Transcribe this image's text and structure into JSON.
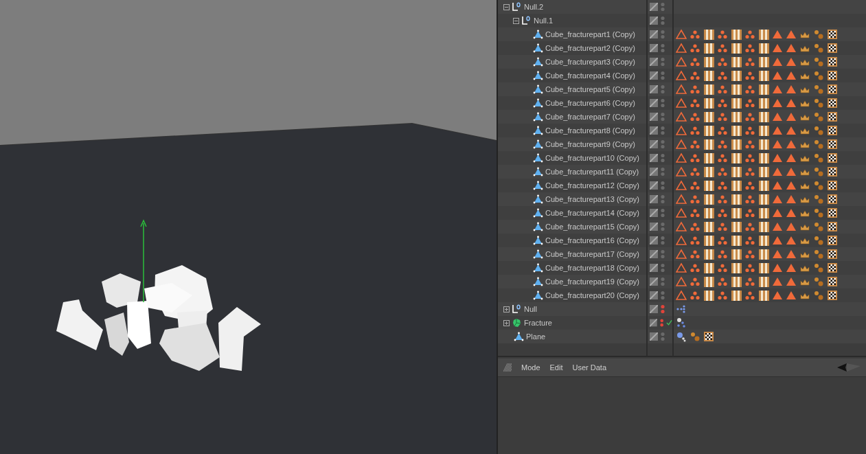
{
  "objects": [
    {
      "name": "Null.2",
      "kind": "null",
      "expanded": true,
      "color": "#6a6a6a",
      "check": false,
      "children": [
        {
          "name": "Null.1",
          "kind": "null",
          "expanded": true,
          "color": "#6a6a6a",
          "check": false,
          "children": [
            {
              "name": "Cube_fracturepart1 (Copy)",
              "kind": "polygon",
              "color": "#6a6a6a",
              "check": false,
              "tags": [
                {
                  "kind": "phong"
                },
                {
                  "kind": "dots"
                },
                {
                  "kind": "checker"
                },
                {
                  "kind": "dots"
                },
                {
                  "kind": "checker"
                },
                {
                  "kind": "dots"
                },
                {
                  "kind": "checker"
                },
                {
                  "kind": "tri"
                },
                {
                  "kind": "tri"
                },
                {
                  "kind": "crown"
                },
                {
                  "kind": "spheres"
                },
                {
                  "kind": "board"
                }
              ]
            },
            {
              "name": "Cube_fracturepart2 (Copy)",
              "kind": "polygon",
              "color": "#6a6a6a",
              "check": false,
              "tags": [
                {
                  "kind": "phong"
                },
                {
                  "kind": "dots"
                },
                {
                  "kind": "checker"
                },
                {
                  "kind": "dots"
                },
                {
                  "kind": "checker"
                },
                {
                  "kind": "dots"
                },
                {
                  "kind": "checker"
                },
                {
                  "kind": "tri"
                },
                {
                  "kind": "tri"
                },
                {
                  "kind": "crown"
                },
                {
                  "kind": "spheres"
                },
                {
                  "kind": "board"
                }
              ]
            },
            {
              "name": "Cube_fracturepart3 (Copy)",
              "kind": "polygon",
              "color": "#6a6a6a",
              "check": false,
              "tags": [
                {
                  "kind": "phong"
                },
                {
                  "kind": "dots"
                },
                {
                  "kind": "checker"
                },
                {
                  "kind": "dots"
                },
                {
                  "kind": "checker"
                },
                {
                  "kind": "dots"
                },
                {
                  "kind": "checker"
                },
                {
                  "kind": "tri"
                },
                {
                  "kind": "tri"
                },
                {
                  "kind": "crown"
                },
                {
                  "kind": "spheres"
                },
                {
                  "kind": "board"
                }
              ]
            },
            {
              "name": "Cube_fracturepart4 (Copy)",
              "kind": "polygon",
              "color": "#6a6a6a",
              "check": false,
              "tags": [
                {
                  "kind": "phong"
                },
                {
                  "kind": "dots"
                },
                {
                  "kind": "checker"
                },
                {
                  "kind": "dots"
                },
                {
                  "kind": "checker"
                },
                {
                  "kind": "dots"
                },
                {
                  "kind": "checker"
                },
                {
                  "kind": "tri"
                },
                {
                  "kind": "tri"
                },
                {
                  "kind": "crown"
                },
                {
                  "kind": "spheres"
                },
                {
                  "kind": "board"
                }
              ]
            },
            {
              "name": "Cube_fracturepart5 (Copy)",
              "kind": "polygon",
              "color": "#6a6a6a",
              "check": false,
              "tags": [
                {
                  "kind": "phong"
                },
                {
                  "kind": "dots"
                },
                {
                  "kind": "checker"
                },
                {
                  "kind": "dots"
                },
                {
                  "kind": "checker"
                },
                {
                  "kind": "dots"
                },
                {
                  "kind": "checker"
                },
                {
                  "kind": "tri"
                },
                {
                  "kind": "tri"
                },
                {
                  "kind": "crown"
                },
                {
                  "kind": "spheres"
                },
                {
                  "kind": "board"
                }
              ]
            },
            {
              "name": "Cube_fracturepart6 (Copy)",
              "kind": "polygon",
              "color": "#6a6a6a",
              "check": false,
              "tags": [
                {
                  "kind": "phong"
                },
                {
                  "kind": "dots"
                },
                {
                  "kind": "checker"
                },
                {
                  "kind": "dots"
                },
                {
                  "kind": "checker"
                },
                {
                  "kind": "dots"
                },
                {
                  "kind": "checker"
                },
                {
                  "kind": "tri"
                },
                {
                  "kind": "tri"
                },
                {
                  "kind": "crown"
                },
                {
                  "kind": "spheres"
                },
                {
                  "kind": "board"
                }
              ]
            },
            {
              "name": "Cube_fracturepart7 (Copy)",
              "kind": "polygon",
              "color": "#6a6a6a",
              "check": false,
              "tags": [
                {
                  "kind": "phong"
                },
                {
                  "kind": "dots"
                },
                {
                  "kind": "checker"
                },
                {
                  "kind": "dots"
                },
                {
                  "kind": "checker"
                },
                {
                  "kind": "dots"
                },
                {
                  "kind": "checker"
                },
                {
                  "kind": "tri"
                },
                {
                  "kind": "tri"
                },
                {
                  "kind": "crown"
                },
                {
                  "kind": "spheres"
                },
                {
                  "kind": "board"
                }
              ]
            },
            {
              "name": "Cube_fracturepart8 (Copy)",
              "kind": "polygon",
              "color": "#6a6a6a",
              "check": false,
              "tags": [
                {
                  "kind": "phong"
                },
                {
                  "kind": "dots"
                },
                {
                  "kind": "checker"
                },
                {
                  "kind": "dots"
                },
                {
                  "kind": "checker"
                },
                {
                  "kind": "dots"
                },
                {
                  "kind": "checker"
                },
                {
                  "kind": "tri"
                },
                {
                  "kind": "tri"
                },
                {
                  "kind": "crown"
                },
                {
                  "kind": "spheres"
                },
                {
                  "kind": "board"
                }
              ]
            },
            {
              "name": "Cube_fracturepart9 (Copy)",
              "kind": "polygon",
              "color": "#6a6a6a",
              "check": false,
              "tags": [
                {
                  "kind": "phong"
                },
                {
                  "kind": "dots"
                },
                {
                  "kind": "checker"
                },
                {
                  "kind": "dots"
                },
                {
                  "kind": "checker"
                },
                {
                  "kind": "dots"
                },
                {
                  "kind": "checker"
                },
                {
                  "kind": "tri"
                },
                {
                  "kind": "tri"
                },
                {
                  "kind": "crown"
                },
                {
                  "kind": "spheres"
                },
                {
                  "kind": "board"
                }
              ]
            },
            {
              "name": "Cube_fracturepart10 (Copy)",
              "kind": "polygon",
              "color": "#6a6a6a",
              "check": false,
              "tags": [
                {
                  "kind": "phong"
                },
                {
                  "kind": "dots"
                },
                {
                  "kind": "checker"
                },
                {
                  "kind": "dots"
                },
                {
                  "kind": "checker"
                },
                {
                  "kind": "dots"
                },
                {
                  "kind": "checker"
                },
                {
                  "kind": "tri"
                },
                {
                  "kind": "tri"
                },
                {
                  "kind": "crown"
                },
                {
                  "kind": "spheres"
                },
                {
                  "kind": "board"
                }
              ]
            },
            {
              "name": "Cube_fracturepart11 (Copy)",
              "kind": "polygon",
              "color": "#6a6a6a",
              "check": false,
              "tags": [
                {
                  "kind": "phong"
                },
                {
                  "kind": "dots"
                },
                {
                  "kind": "checker"
                },
                {
                  "kind": "dots"
                },
                {
                  "kind": "checker"
                },
                {
                  "kind": "dots"
                },
                {
                  "kind": "checker"
                },
                {
                  "kind": "tri"
                },
                {
                  "kind": "tri"
                },
                {
                  "kind": "crown"
                },
                {
                  "kind": "spheres"
                },
                {
                  "kind": "board"
                }
              ]
            },
            {
              "name": "Cube_fracturepart12 (Copy)",
              "kind": "polygon",
              "color": "#6a6a6a",
              "check": false,
              "tags": [
                {
                  "kind": "phong"
                },
                {
                  "kind": "dots"
                },
                {
                  "kind": "checker"
                },
                {
                  "kind": "dots"
                },
                {
                  "kind": "checker"
                },
                {
                  "kind": "dots"
                },
                {
                  "kind": "checker"
                },
                {
                  "kind": "tri"
                },
                {
                  "kind": "tri"
                },
                {
                  "kind": "crown"
                },
                {
                  "kind": "spheres"
                },
                {
                  "kind": "board"
                }
              ]
            },
            {
              "name": "Cube_fracturepart13 (Copy)",
              "kind": "polygon",
              "color": "#6a6a6a",
              "check": false,
              "tags": [
                {
                  "kind": "phong"
                },
                {
                  "kind": "dots"
                },
                {
                  "kind": "checker"
                },
                {
                  "kind": "dots"
                },
                {
                  "kind": "checker"
                },
                {
                  "kind": "dots"
                },
                {
                  "kind": "checker"
                },
                {
                  "kind": "tri"
                },
                {
                  "kind": "tri"
                },
                {
                  "kind": "crown"
                },
                {
                  "kind": "spheres"
                },
                {
                  "kind": "board"
                }
              ]
            },
            {
              "name": "Cube_fracturepart14 (Copy)",
              "kind": "polygon",
              "color": "#6a6a6a",
              "check": false,
              "tags": [
                {
                  "kind": "phong"
                },
                {
                  "kind": "dots"
                },
                {
                  "kind": "checker"
                },
                {
                  "kind": "dots"
                },
                {
                  "kind": "checker"
                },
                {
                  "kind": "dots"
                },
                {
                  "kind": "checker"
                },
                {
                  "kind": "tri"
                },
                {
                  "kind": "tri"
                },
                {
                  "kind": "crown"
                },
                {
                  "kind": "spheres"
                },
                {
                  "kind": "board"
                }
              ]
            },
            {
              "name": "Cube_fracturepart15 (Copy)",
              "kind": "polygon",
              "color": "#6a6a6a",
              "check": false,
              "tags": [
                {
                  "kind": "phong"
                },
                {
                  "kind": "dots"
                },
                {
                  "kind": "checker"
                },
                {
                  "kind": "dots"
                },
                {
                  "kind": "checker"
                },
                {
                  "kind": "dots"
                },
                {
                  "kind": "checker"
                },
                {
                  "kind": "tri"
                },
                {
                  "kind": "tri"
                },
                {
                  "kind": "crown"
                },
                {
                  "kind": "spheres"
                },
                {
                  "kind": "board"
                }
              ]
            },
            {
              "name": "Cube_fracturepart16 (Copy)",
              "kind": "polygon",
              "color": "#6a6a6a",
              "check": false,
              "tags": [
                {
                  "kind": "phong"
                },
                {
                  "kind": "dots"
                },
                {
                  "kind": "checker"
                },
                {
                  "kind": "dots"
                },
                {
                  "kind": "checker"
                },
                {
                  "kind": "dots"
                },
                {
                  "kind": "checker"
                },
                {
                  "kind": "tri"
                },
                {
                  "kind": "tri"
                },
                {
                  "kind": "crown"
                },
                {
                  "kind": "spheres"
                },
                {
                  "kind": "board"
                }
              ]
            },
            {
              "name": "Cube_fracturepart17 (Copy)",
              "kind": "polygon",
              "color": "#6a6a6a",
              "check": false,
              "tags": [
                {
                  "kind": "phong"
                },
                {
                  "kind": "dots"
                },
                {
                  "kind": "checker"
                },
                {
                  "kind": "dots"
                },
                {
                  "kind": "checker"
                },
                {
                  "kind": "dots"
                },
                {
                  "kind": "checker"
                },
                {
                  "kind": "tri"
                },
                {
                  "kind": "tri"
                },
                {
                  "kind": "crown"
                },
                {
                  "kind": "spheres"
                },
                {
                  "kind": "board"
                }
              ]
            },
            {
              "name": "Cube_fracturepart18 (Copy)",
              "kind": "polygon",
              "color": "#6a6a6a",
              "check": false,
              "tags": [
                {
                  "kind": "phong"
                },
                {
                  "kind": "dots"
                },
                {
                  "kind": "checker"
                },
                {
                  "kind": "dots"
                },
                {
                  "kind": "checker"
                },
                {
                  "kind": "dots"
                },
                {
                  "kind": "checker"
                },
                {
                  "kind": "tri"
                },
                {
                  "kind": "tri"
                },
                {
                  "kind": "crown"
                },
                {
                  "kind": "spheres"
                },
                {
                  "kind": "board"
                }
              ]
            },
            {
              "name": "Cube_fracturepart19 (Copy)",
              "kind": "polygon",
              "color": "#6a6a6a",
              "check": false,
              "tags": [
                {
                  "kind": "phong"
                },
                {
                  "kind": "dots"
                },
                {
                  "kind": "checker"
                },
                {
                  "kind": "dots"
                },
                {
                  "kind": "checker"
                },
                {
                  "kind": "dots"
                },
                {
                  "kind": "checker"
                },
                {
                  "kind": "tri"
                },
                {
                  "kind": "tri"
                },
                {
                  "kind": "crown"
                },
                {
                  "kind": "spheres"
                },
                {
                  "kind": "board"
                }
              ]
            },
            {
              "name": "Cube_fracturepart20 (Copy)",
              "kind": "polygon",
              "color": "#6a6a6a",
              "check": false,
              "tags": [
                {
                  "kind": "phong"
                },
                {
                  "kind": "dots"
                },
                {
                  "kind": "checker"
                },
                {
                  "kind": "dots"
                },
                {
                  "kind": "checker"
                },
                {
                  "kind": "dots"
                },
                {
                  "kind": "checker"
                },
                {
                  "kind": "tri"
                },
                {
                  "kind": "tri"
                },
                {
                  "kind": "crown"
                },
                {
                  "kind": "spheres"
                },
                {
                  "kind": "board"
                }
              ]
            }
          ]
        }
      ]
    },
    {
      "name": "Null",
      "kind": "null",
      "expanded": false,
      "color": "#e0443a",
      "check": false,
      "tags": [
        {
          "kind": "xpresso"
        }
      ]
    },
    {
      "name": "Fracture",
      "kind": "fracture",
      "expanded": false,
      "color": "#e0443a",
      "check": true,
      "tags": [
        {
          "kind": "mograph"
        }
      ]
    },
    {
      "name": "Plane",
      "kind": "polygon",
      "color": "#6a6a6a",
      "check": false,
      "tags": [
        {
          "kind": "sphere-set"
        },
        {
          "kind": "spheres"
        },
        {
          "kind": "board"
        }
      ]
    }
  ],
  "attributes": {
    "menu": [
      "Mode",
      "Edit",
      "User Data"
    ]
  }
}
